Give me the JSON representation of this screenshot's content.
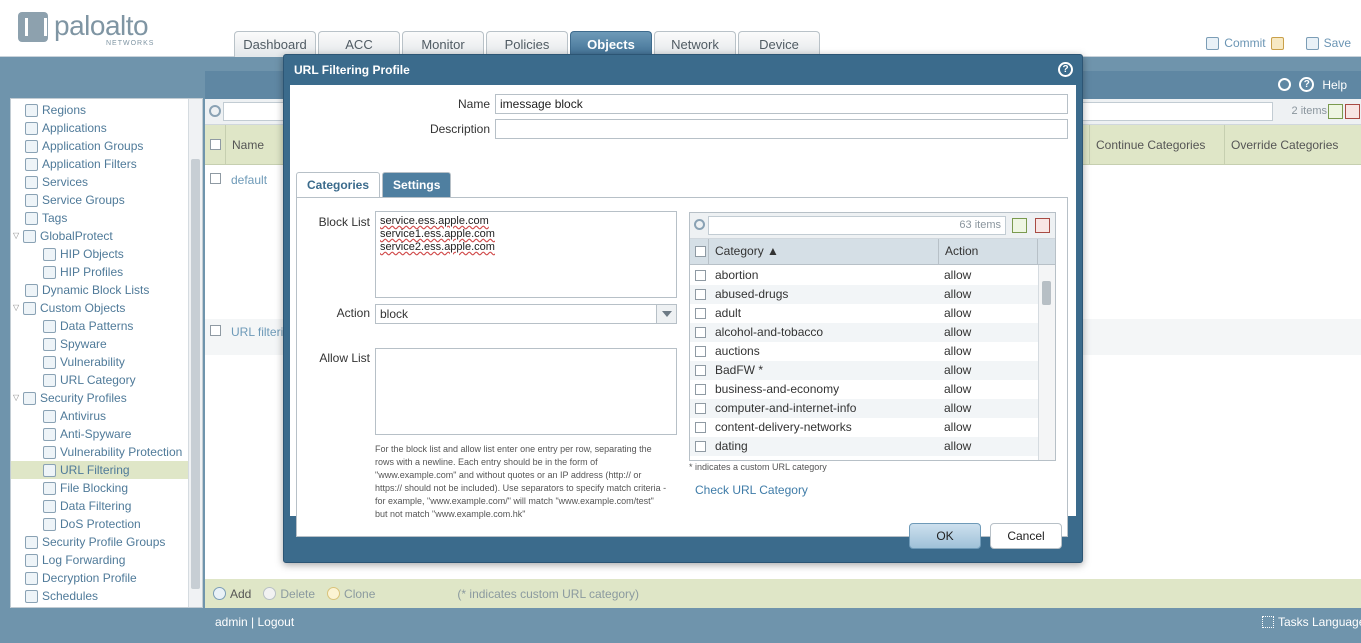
{
  "brand": {
    "name": "paloalto",
    "sub": "NETWORKS"
  },
  "tabs": [
    "Dashboard",
    "ACC",
    "Monitor",
    "Policies",
    "Objects",
    "Network",
    "Device"
  ],
  "header_actions": {
    "commit": "Commit",
    "save": "Save"
  },
  "tree": [
    {
      "label": "Regions",
      "indent": 1
    },
    {
      "label": "Applications",
      "indent": 1
    },
    {
      "label": "Application Groups",
      "indent": 1
    },
    {
      "label": "Application Filters",
      "indent": 1
    },
    {
      "label": "Services",
      "indent": 1
    },
    {
      "label": "Service Groups",
      "indent": 1
    },
    {
      "label": "Tags",
      "indent": 1
    },
    {
      "label": "GlobalProtect",
      "indent": 0
    },
    {
      "label": "HIP Objects",
      "indent": 2
    },
    {
      "label": "HIP Profiles",
      "indent": 2
    },
    {
      "label": "Dynamic Block Lists",
      "indent": 1
    },
    {
      "label": "Custom Objects",
      "indent": 0
    },
    {
      "label": "Data Patterns",
      "indent": 2
    },
    {
      "label": "Spyware",
      "indent": 2
    },
    {
      "label": "Vulnerability",
      "indent": 2
    },
    {
      "label": "URL Category",
      "indent": 2
    },
    {
      "label": "Security Profiles",
      "indent": 0
    },
    {
      "label": "Antivirus",
      "indent": 2
    },
    {
      "label": "Anti-Spyware",
      "indent": 2
    },
    {
      "label": "Vulnerability Protection",
      "indent": 2
    },
    {
      "label": "URL Filtering",
      "indent": 2,
      "selected": true
    },
    {
      "label": "File Blocking",
      "indent": 2
    },
    {
      "label": "Data Filtering",
      "indent": 2
    },
    {
      "label": "DoS Protection",
      "indent": 2
    },
    {
      "label": "Security Profile Groups",
      "indent": 1
    },
    {
      "label": "Log Forwarding",
      "indent": 1
    },
    {
      "label": "Decryption Profile",
      "indent": 1
    },
    {
      "label": "Schedules",
      "indent": 1
    }
  ],
  "main": {
    "help": "Help",
    "items_count": "2 items",
    "columns": {
      "name": "Name",
      "continue": "Continue Categories",
      "override": "Override Categories"
    },
    "rows": [
      "default",
      "URL filterin"
    ]
  },
  "bottom": {
    "add": "Add",
    "delete": "Delete",
    "clone": "Clone",
    "note": "(* indicates custom URL category)"
  },
  "status": {
    "user": "admin",
    "logout": "Logout",
    "tasks": "Tasks",
    "language": "Language"
  },
  "dialog": {
    "title": "URL Filtering Profile",
    "name_label": "Name",
    "name_value": "imessage block",
    "desc_label": "Description",
    "desc_value": "",
    "tabs": {
      "categories": "Categories",
      "settings": "Settings"
    },
    "block_label": "Block List",
    "block_list": "service.ess.apple.com\nservice1.ess.apple.com\nservice2.ess.apple.com",
    "action_label": "Action",
    "action_value": "block",
    "allow_label": "Allow List",
    "allow_list": "",
    "help_text": "For the block list and allow list enter one entry per row, separating the rows with a newline. Each entry should be in the form of \"www.example.com\" and without quotes or an IP address (http:// or https:// should not be included). Use separators to specify match criteria - for example, \"www.example.com/\" will match \"www.example.com/test\" but not match \"www.example.com.hk\"",
    "cat_count": "63 items",
    "cat_head": {
      "category": "Category ▲",
      "action": "Action"
    },
    "categories": [
      {
        "name": "abortion",
        "action": "allow"
      },
      {
        "name": "abused-drugs",
        "action": "allow"
      },
      {
        "name": "adult",
        "action": "allow"
      },
      {
        "name": "alcohol-and-tobacco",
        "action": "allow"
      },
      {
        "name": "auctions",
        "action": "allow"
      },
      {
        "name": "BadFW *",
        "action": "allow"
      },
      {
        "name": "business-and-economy",
        "action": "allow"
      },
      {
        "name": "computer-and-internet-info",
        "action": "allow"
      },
      {
        "name": "content-delivery-networks",
        "action": "allow"
      },
      {
        "name": "dating",
        "action": "allow"
      }
    ],
    "custom_note": "* indicates a custom URL category",
    "check_link": "Check URL Category",
    "ok": "OK",
    "cancel": "Cancel"
  }
}
